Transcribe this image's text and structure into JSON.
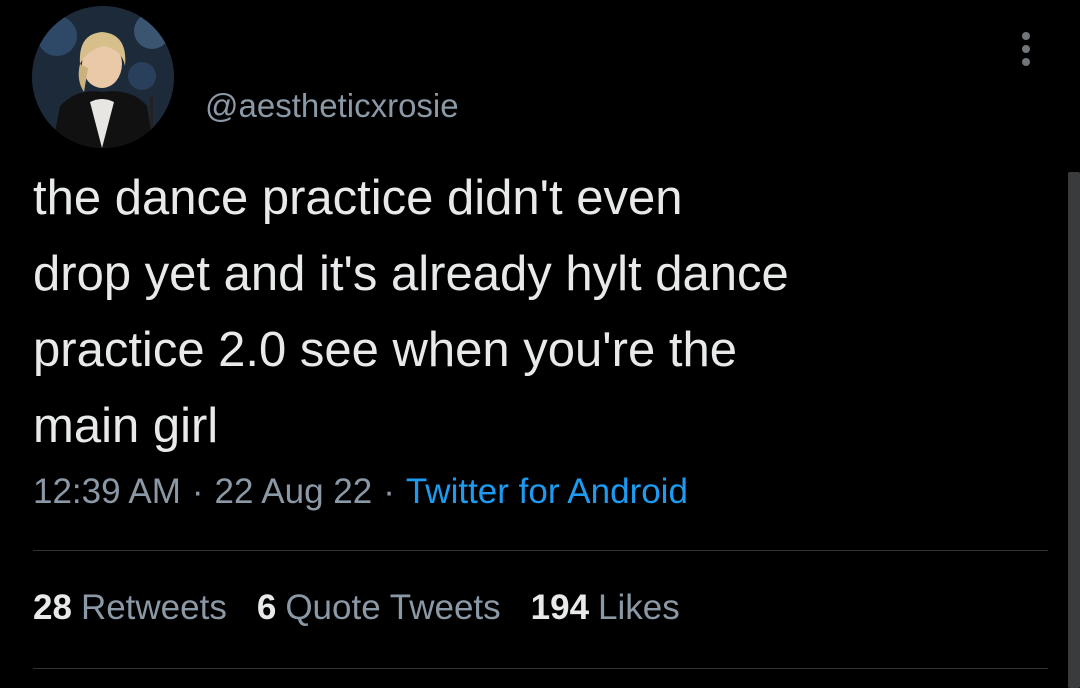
{
  "tweet": {
    "handle": "@aestheticxrosie",
    "text": "the dance practice didn't even\ndrop yet and it's already hylt dance\npractice 2.0 see when you're the\nmain girl",
    "time": "12:39 AM",
    "date": "22 Aug 22",
    "separator": "·",
    "source": "Twitter for Android"
  },
  "stats": {
    "retweets_count": "28",
    "retweets_label": "Retweets",
    "quotes_count": "6",
    "quotes_label": "Quote Tweets",
    "likes_count": "194",
    "likes_label": "Likes"
  },
  "icons": {
    "more": "more-options-icon"
  },
  "colors": {
    "background": "#000000",
    "text": "#e7e9ea",
    "secondary": "#8b98a5",
    "link": "#1d9bf0",
    "divider": "#2f3336"
  }
}
